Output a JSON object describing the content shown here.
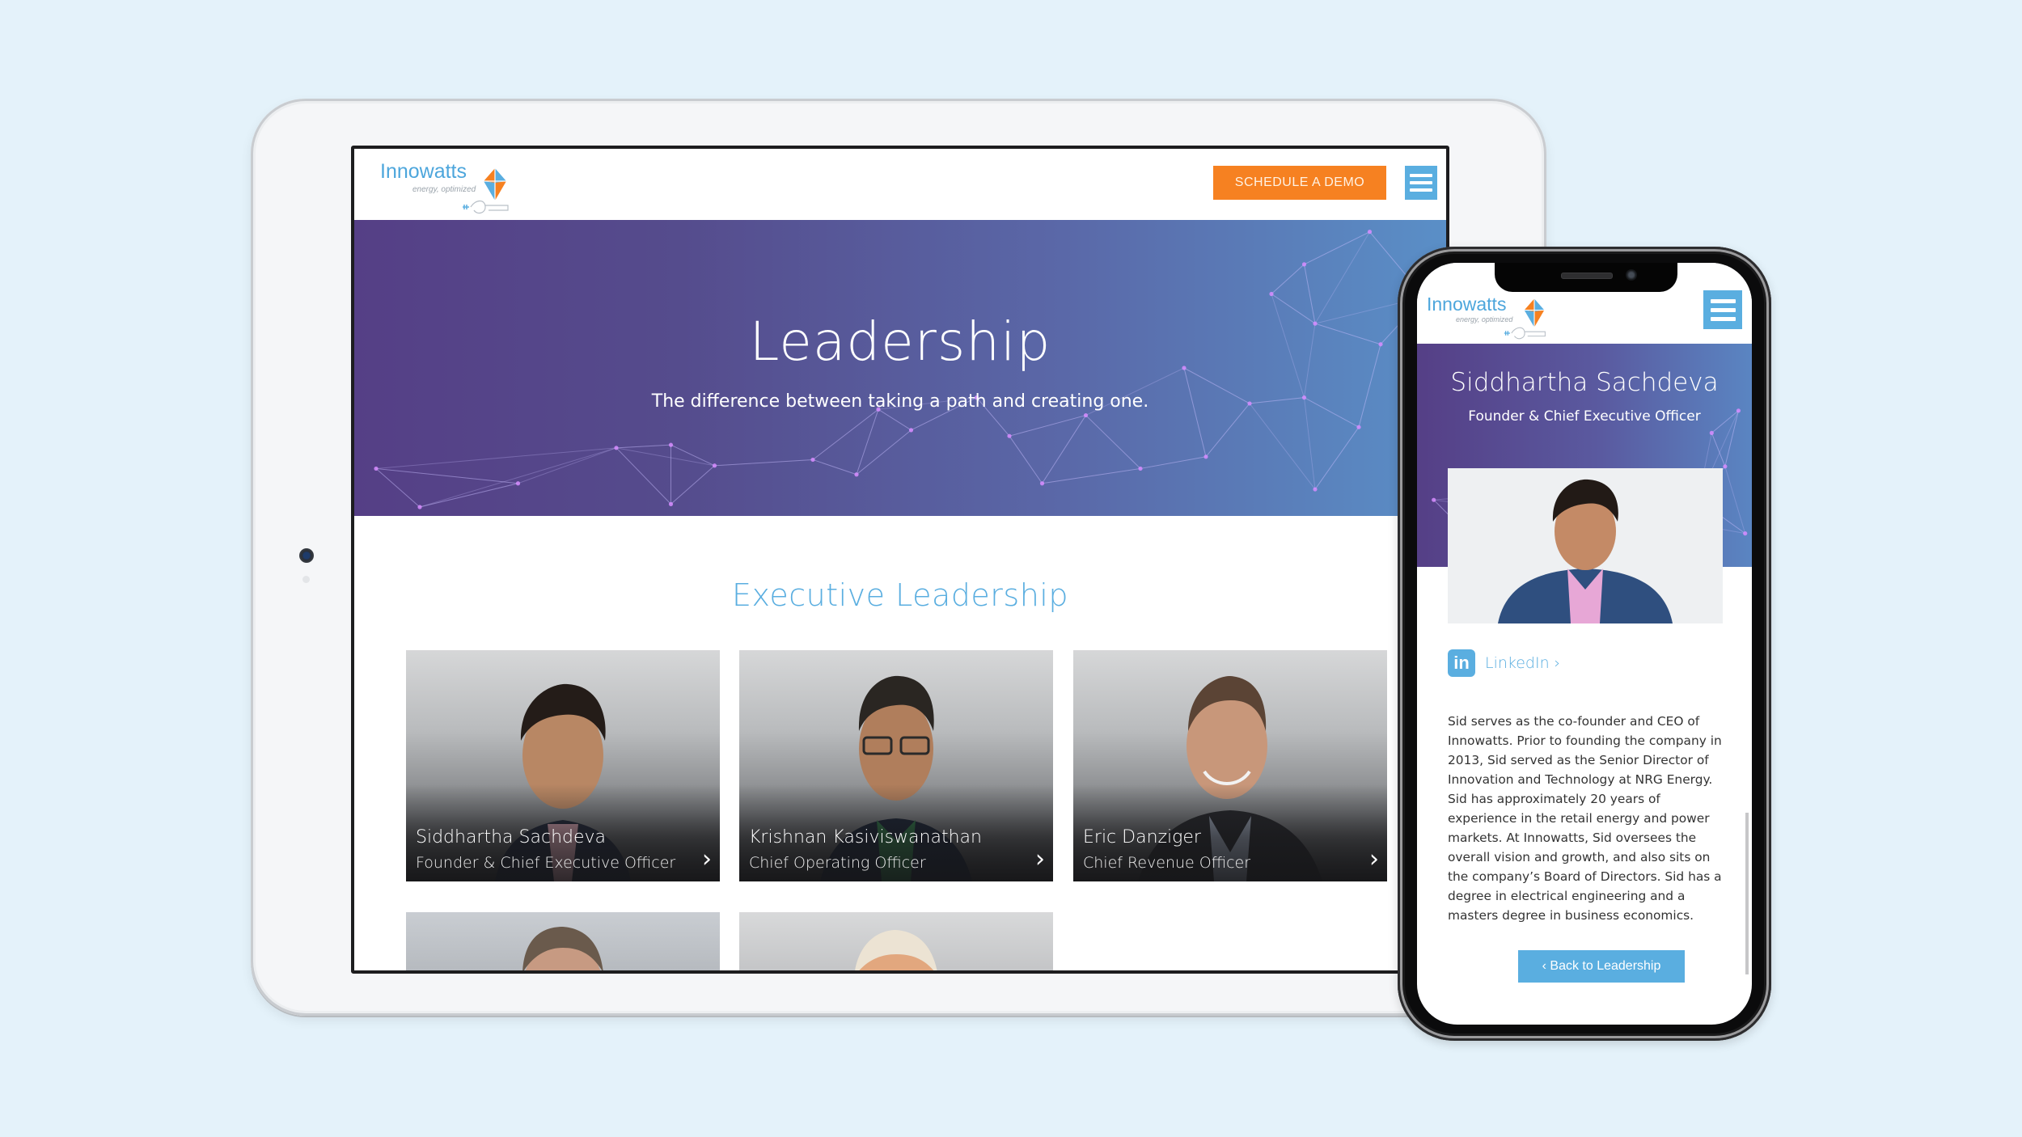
{
  "brand": {
    "name": "Innowatts",
    "tagline": "energy, optimized",
    "colors": {
      "primary_blue": "#5aaee0",
      "accent_orange": "#f68121",
      "hero_purple": "#553f86",
      "hero_blue": "#5a8fc7",
      "background": "#e4f2fa"
    }
  },
  "tablet": {
    "header": {
      "logo_icon": "kite-logo-icon",
      "cta_label": "SCHEDULE A DEMO",
      "menu_icon": "hamburger-menu-icon"
    },
    "hero": {
      "title": "Leadership",
      "subtitle": "The difference between taking a path and creating one."
    },
    "section_title": "Executive Leadership",
    "team": [
      {
        "name": "Siddhartha Sachdeva",
        "role": "Founder & Chief Executive Officer",
        "arrow_icon": "chevron-right-icon"
      },
      {
        "name": "Krishnan Kasiviswanathan",
        "role": "Chief Operating Officer",
        "arrow_icon": "chevron-right-icon"
      },
      {
        "name": "Eric Danziger",
        "role": "Chief Revenue Officer",
        "arrow_icon": "chevron-right-icon"
      }
    ]
  },
  "phone": {
    "header": {
      "menu_icon": "hamburger-menu-icon"
    },
    "profile": {
      "name": "Siddhartha Sachdeva",
      "role": "Founder & Chief Executive Officer",
      "linkedin_icon": "in",
      "linkedin_label": "LinkedIn ›",
      "bio": "Sid serves as the co-founder and CEO of Innowatts. Prior to founding the company in 2013, Sid served as the Senior Director of Innovation and Technology at NRG Energy. Sid has approximately 20 years of experience in the retail energy and power markets. At Innowatts, Sid oversees the overall vision and growth, and also sits on the company’s Board of Directors. Sid has a degree in electrical engineering and a masters degree in business economics.",
      "back_label": "‹ Back to Leadership"
    }
  }
}
